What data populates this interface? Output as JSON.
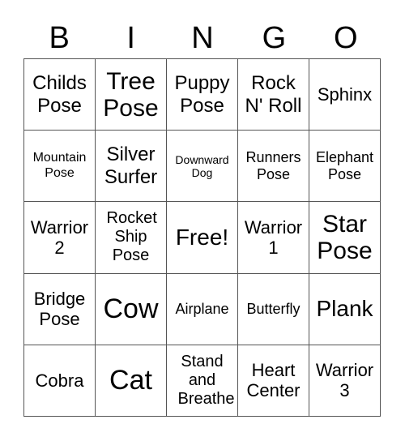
{
  "header": {
    "letters": [
      "B",
      "I",
      "N",
      "G",
      "O"
    ]
  },
  "cells": [
    [
      "Childs Pose",
      "Tree Pose",
      "Puppy Pose",
      "Rock N' Roll",
      "Sphinx"
    ],
    [
      "Mountain Pose",
      "Silver Surfer",
      "Downward Dog",
      "Runners Pose",
      "Elephant Pose"
    ],
    [
      "Warrior 2",
      "Rocket Ship Pose",
      "Free!",
      "Warrior 1",
      "Star Pose"
    ],
    [
      "Bridge Pose",
      "Cow",
      "Airplane",
      "Butterfly",
      "Plank"
    ],
    [
      "Cobra",
      "Cat",
      "Stand and Breathe",
      "Heart Center",
      "Warrior 3"
    ]
  ]
}
